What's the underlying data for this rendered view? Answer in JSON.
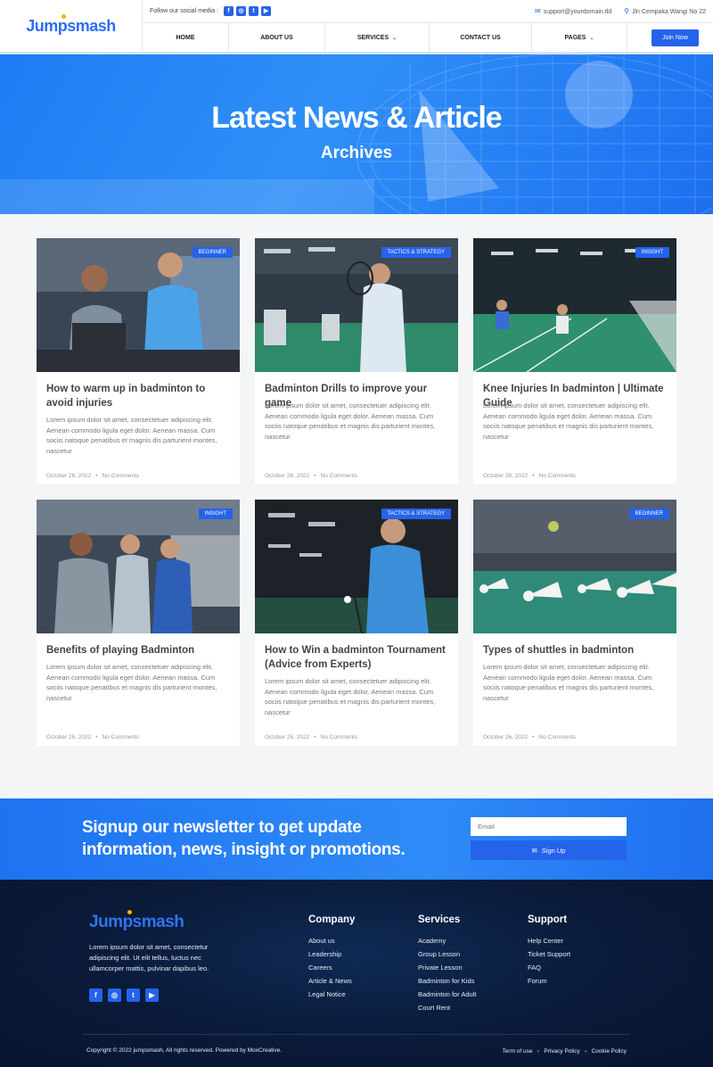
{
  "brand": {
    "name": "Jumpsmash"
  },
  "topbar": {
    "social_label": "Follow our social media :",
    "social_icons": [
      "facebook-icon",
      "instagram-icon",
      "twitter-icon",
      "youtube-icon"
    ],
    "email": "support@yourdomain.tld",
    "address": "Jln Cempaka Wangi No 22"
  },
  "nav": {
    "items": [
      {
        "label": "HOME"
      },
      {
        "label": "ABOUT US"
      },
      {
        "label": "SERVICES"
      },
      {
        "label": "CONTACT US"
      },
      {
        "label": "PAGES"
      }
    ],
    "cta": "Join Now"
  },
  "hero": {
    "title": "Latest News & Article",
    "subtitle": "Archives"
  },
  "posts": [
    {
      "category": "BEGINNER",
      "title": "How to warm up in badminton to avoid injuries",
      "excerpt": "Lorem ipsum dolor sit amet, consectetuer adipiscing elit. Aenean commodo ligula eget dolor. Aenean massa. Cum sociis natoque penatibus et magnis dis parturient montes, nascetur",
      "date": "October 26, 2022",
      "comments": "No Comments"
    },
    {
      "category": "TACTICS & STRATEGY",
      "title": "Badminton Drills to improve your game",
      "excerpt": "Lorem ipsum dolor sit amet, consectetuer adipiscing elit. Aenean commodo ligula eget dolor. Aenean massa. Cum sociis natoque penatibus et magnis dis parturient montes, nascetur",
      "date": "October 26, 2022",
      "comments": "No Comments"
    },
    {
      "category": "INSIGHT",
      "title": "Knee Injuries In badminton | Ultimate Guide",
      "excerpt": "Lorem ipsum dolor sit amet, consectetuer adipiscing elit. Aenean commodo ligula eget dolor. Aenean massa. Cum sociis natoque penatibus et magnis dis parturient montes, nascetur",
      "date": "October 26, 2022",
      "comments": "No Comments"
    },
    {
      "category": "INSIGHT",
      "title": "Benefits of playing Badminton",
      "excerpt": "Lorem ipsum dolor sit amet, consectetuer adipiscing elit. Aenean commodo ligula eget dolor. Aenean massa. Cum sociis natoque penatibus et magnis dis parturient montes, nascetur",
      "date": "October 26, 2022",
      "comments": "No Comments"
    },
    {
      "category": "TACTICS & STRATEGY",
      "title": "How to Win a badminton Tournament (Advice from Experts)",
      "excerpt": "Lorem ipsum dolor sit amet, consectetuer adipiscing elit. Aenean commodo ligula eget dolor. Aenean massa. Cum sociis natoque penatibus et magnis dis parturient montes, nascetur",
      "date": "October 26, 2022",
      "comments": "No Comments"
    },
    {
      "category": "BEGINNER",
      "title": "Types of shuttles in badminton",
      "excerpt": "Lorem ipsum dolor sit amet, consectetuer adipiscing elit. Aenean commodo ligula eget dolor. Aenean massa. Cum sociis natoque penatibus et magnis dis parturient montes, nascetur",
      "date": "October 26, 2022",
      "comments": "No Comments"
    }
  ],
  "newsletter": {
    "title": "Signup our newsletter to get update information, news, insight or promotions.",
    "email_placeholder": "Email",
    "button": "Sign Up"
  },
  "footer": {
    "about": "Lorem ipsum dolor sit amet, consectetur adipiscing elit. Ut elit tellus, luctus nec ullamcorper mattis, pulvinar dapibus leo.",
    "columns": [
      {
        "heading": "Company",
        "links": [
          "About us",
          "Leadership",
          "Careers",
          "Article & News",
          "Legal Notice"
        ]
      },
      {
        "heading": "Services",
        "links": [
          "Academy",
          "Group Lesson",
          "Private Lesson",
          "Badminton for Kids",
          "Badminton for Adult",
          "Court Rent"
        ]
      },
      {
        "heading": "Support",
        "links": [
          "Help Center",
          "Ticket Support",
          "FAQ",
          "Forum"
        ]
      }
    ],
    "copyright": "Copyright © 2022 jumpsmash, All rights reserved. Powered by MoxCreative.",
    "legal": [
      "Term of use",
      "Privacy Policy",
      "Cookie Policy"
    ]
  },
  "colors": {
    "primary": "#2563eb",
    "hero": "#1f7cf4",
    "footer_bg": "#0a1a38",
    "accent_dot": "#f5b301"
  }
}
